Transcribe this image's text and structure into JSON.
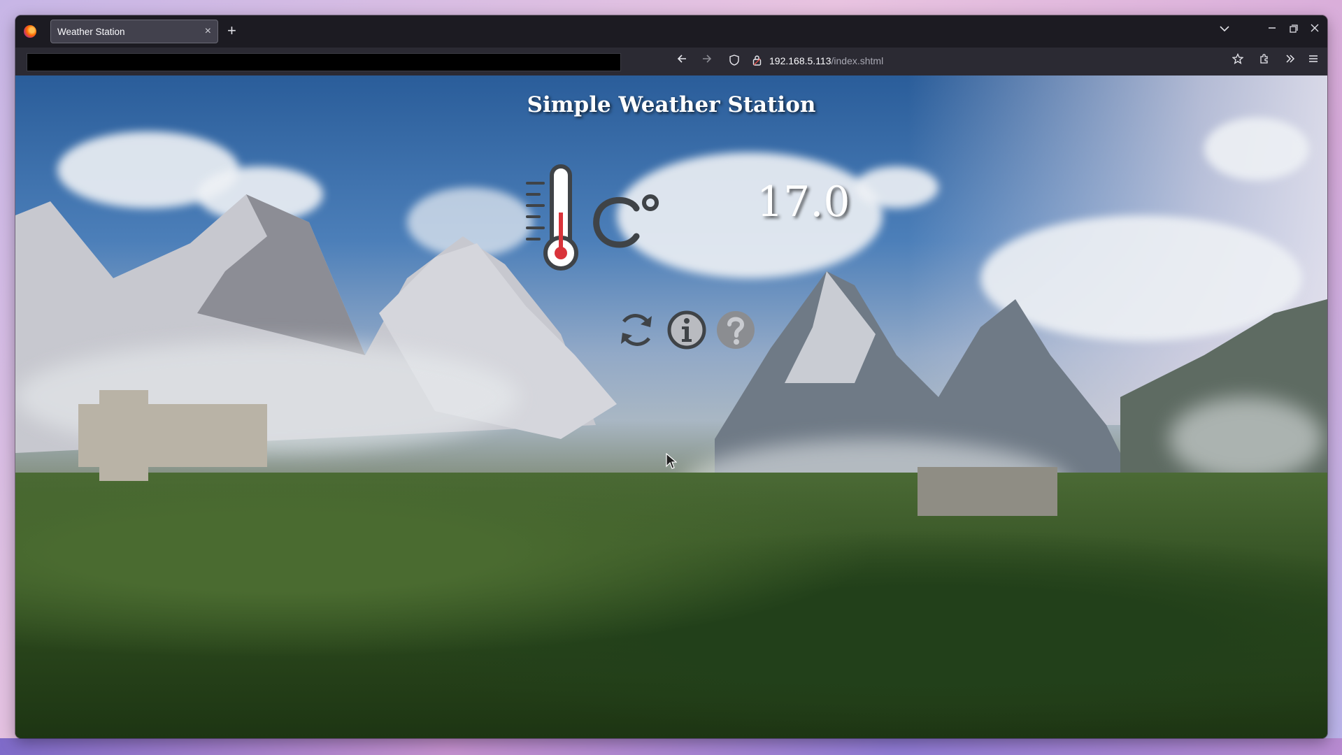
{
  "browser": {
    "tab_title": "Weather Station",
    "tab_close": "×",
    "new_tab": "+",
    "url_host": "192.168.5.113",
    "url_path": "/index.shtml"
  },
  "page": {
    "title": "Simple Weather Station",
    "temperature": "17.0",
    "unit_icon": "celsius-icon"
  },
  "icons": {
    "refresh": "refresh-icon",
    "info": "info-icon",
    "help": "help-icon"
  }
}
